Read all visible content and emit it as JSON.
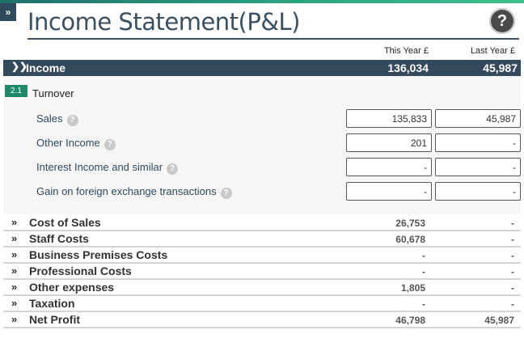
{
  "page": {
    "title": "Income Statement(P&L)",
    "expand_glyph": "»",
    "help_glyph": "?"
  },
  "columns": {
    "this_year": "This Year £",
    "last_year": "Last Year £"
  },
  "income": {
    "label": "Income",
    "this_year": "136,034",
    "last_year": "45,987"
  },
  "turnover": {
    "badge": "2.1",
    "title": "Turnover",
    "fields": [
      {
        "label": "Sales",
        "this_year": "135,833",
        "last_year": "45,987"
      },
      {
        "label": "Other Income",
        "this_year": "201",
        "last_year": "-"
      },
      {
        "label": "Interest Income and similar",
        "this_year": "-",
        "last_year": "-"
      },
      {
        "label": "Gain on foreign exchange transactions",
        "this_year": "-",
        "last_year": "-"
      }
    ]
  },
  "categories": [
    {
      "label": "Cost of Sales",
      "this_year": "26,753",
      "last_year": "-"
    },
    {
      "label": "Staff Costs",
      "this_year": "60,678",
      "last_year": "-"
    },
    {
      "label": "Business Premises Costs",
      "this_year": "-",
      "last_year": "-"
    },
    {
      "label": "Professional Costs",
      "this_year": "-",
      "last_year": "-"
    },
    {
      "label": "Other expenses",
      "this_year": "1,805",
      "last_year": "-"
    },
    {
      "label": "Taxation",
      "this_year": "-",
      "last_year": "-"
    },
    {
      "label": "Net Profit",
      "this_year": "46,798",
      "last_year": "45,987"
    }
  ],
  "icons": {
    "expand": "double-chevron-right-icon",
    "collapse": "double-chevron-down-icon",
    "help": "question-circle-icon"
  },
  "colors": {
    "header_bg": "#34495b",
    "accent": "#1f8a6a"
  }
}
